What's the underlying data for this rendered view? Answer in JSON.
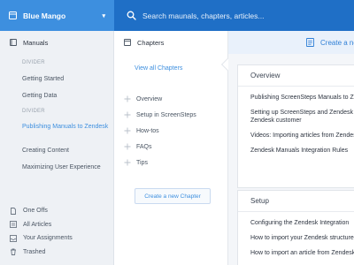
{
  "brand": {
    "name": "Blue Mango"
  },
  "search": {
    "placeholder": "Search maunals, chapters, articles..."
  },
  "sidebar": {
    "header": "Manuals",
    "items": [
      {
        "type": "divider",
        "label": "DIVIDER"
      },
      {
        "type": "item",
        "label": "Getting Started"
      },
      {
        "type": "item",
        "label": "Getting Data"
      },
      {
        "type": "divider",
        "label": "DIVIDER"
      },
      {
        "type": "item",
        "label": "Publishing Manuals to Zendesk",
        "active": true
      },
      {
        "type": "item",
        "label": "Creating Content"
      },
      {
        "type": "item",
        "label": "Maximizing User Experience"
      }
    ],
    "bottom": [
      {
        "label": "One Offs",
        "icon": "document-icon"
      },
      {
        "label": "All Articles",
        "icon": "list-icon"
      },
      {
        "label": "Your Assignments",
        "icon": "inbox-icon"
      },
      {
        "label": "Trashed",
        "icon": "trash-icon"
      }
    ]
  },
  "chapters": {
    "header": "Chapters",
    "view_all": "View all Chapters",
    "items": [
      "Overview",
      "Setup in ScreenSteps",
      "How-tos",
      "FAQs",
      "Tips"
    ],
    "create_label": "Create a new Chapter"
  },
  "main": {
    "create_label": "Create a new Article",
    "sections": [
      {
        "title": "Overview",
        "articles": [
          "Publishing ScreenSteps Manuals to Zendesk",
          "Setting up ScreenSteps and Zendesk",
          "Zendesk customer",
          "Videos: Importing articles from Zendesk",
          "Zendesk Manuals Integration Rules"
        ]
      },
      {
        "title": "Setup",
        "articles": [
          "Configuring the Zendesk Integration",
          "How to import your Zendesk structure",
          "How to import an article from Zendesk"
        ]
      }
    ]
  },
  "colors": {
    "accent": "#3d8fdf",
    "topbar": "#1f6fc6",
    "sidebar_bg": "#eef1f5"
  }
}
